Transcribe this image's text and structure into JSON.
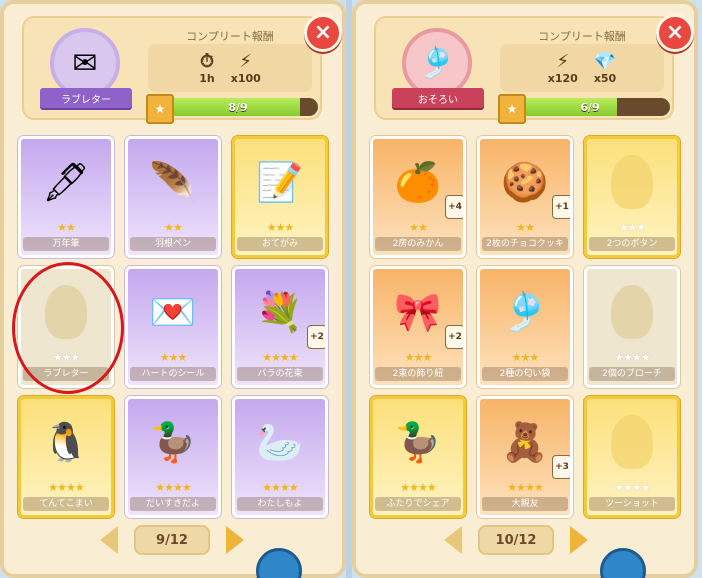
{
  "left": {
    "reward_title": "コンプリート報酬",
    "badge_label": "ラブレター",
    "rewards": [
      {
        "icon": "clock-icon",
        "glyph": "⏱",
        "amount": "1h"
      },
      {
        "icon": "lightning-icon",
        "glyph": "⚡",
        "amount": "x100"
      }
    ],
    "progress_text": "8/9",
    "progress_value": 0.89,
    "cards": [
      {
        "name": "万年筆",
        "stars": "★★",
        "style": "purple",
        "icon": "fountain-pen",
        "glyph": "🖋",
        "count": ""
      },
      {
        "name": "羽根ペン",
        "stars": "★★",
        "style": "purple",
        "icon": "quill-pen",
        "glyph": "🪶",
        "count": ""
      },
      {
        "name": "おてがみ",
        "stars": "★★★",
        "style": "gold",
        "icon": "letter-writing",
        "glyph": "📝",
        "count": ""
      },
      {
        "name": "ラブレター",
        "stars": "★★★",
        "style": "locked",
        "icon": "locked-silhouette",
        "glyph": "",
        "count": ""
      },
      {
        "name": "ハートのシール",
        "stars": "★★★",
        "style": "purple",
        "icon": "heart-envelope",
        "glyph": "💌",
        "count": ""
      },
      {
        "name": "バラの花束",
        "stars": "★★★★",
        "style": "purple",
        "icon": "rose-bouquet",
        "glyph": "💐",
        "count": "2"
      },
      {
        "name": "てんてこまい",
        "stars": "★★★★",
        "style": "gold",
        "icon": "busy-character",
        "glyph": "🐧",
        "count": ""
      },
      {
        "name": "だいすきだよ",
        "stars": "★★★★",
        "style": "purple",
        "icon": "duck-with-letter",
        "glyph": "🦆",
        "count": ""
      },
      {
        "name": "わたしもよ",
        "stars": "★★★★",
        "style": "purple",
        "icon": "duck-with-flowers",
        "glyph": "🦢",
        "count": ""
      }
    ],
    "page": "9/12"
  },
  "right": {
    "reward_title": "コンプリート報酬",
    "badge_label": "おそろい",
    "rewards": [
      {
        "icon": "lightning-icon",
        "glyph": "⚡",
        "amount": "x120"
      },
      {
        "icon": "gem-icon",
        "glyph": "💎",
        "amount": "x50"
      }
    ],
    "progress_text": "6/9",
    "progress_value": 0.67,
    "cards": [
      {
        "name": "2房のみかん",
        "stars": "★★",
        "style": "orange",
        "icon": "orange-slices",
        "glyph": "🍊",
        "count": "4"
      },
      {
        "name": "2枚のチョコクッキー",
        "stars": "★★",
        "style": "orange",
        "icon": "heart-cookies",
        "glyph": "🍪",
        "count": "1"
      },
      {
        "name": "2つのボタン",
        "stars": "★★★",
        "style": "gold",
        "icon": "locked-silhouette",
        "glyph": "",
        "count": ""
      },
      {
        "name": "2束の飾り紐",
        "stars": "★★★",
        "style": "orange",
        "icon": "ribbon-cords",
        "glyph": "🎀",
        "count": "2"
      },
      {
        "name": "2種の匂い袋",
        "stars": "★★★",
        "style": "orange",
        "icon": "scent-bags",
        "glyph": "🎐",
        "count": ""
      },
      {
        "name": "2個のブローチ",
        "stars": "★★★★",
        "style": "locked",
        "icon": "locked-silhouette",
        "glyph": "",
        "count": ""
      },
      {
        "name": "ふたりでシェア",
        "stars": "★★★★",
        "style": "gold",
        "icon": "two-ducks",
        "glyph": "🦆",
        "count": ""
      },
      {
        "name": "大親友",
        "stars": "★★★★",
        "style": "orange",
        "icon": "best-friends",
        "glyph": "🧸",
        "count": "3"
      },
      {
        "name": "ツーショット",
        "stars": "★★★★",
        "style": "gold",
        "icon": "locked-silhouette",
        "glyph": "",
        "count": ""
      }
    ],
    "page": "10/12"
  },
  "colors": {
    "accent": "#e8483f",
    "progress": "#86cc2f",
    "highlight": "#d9161b"
  }
}
